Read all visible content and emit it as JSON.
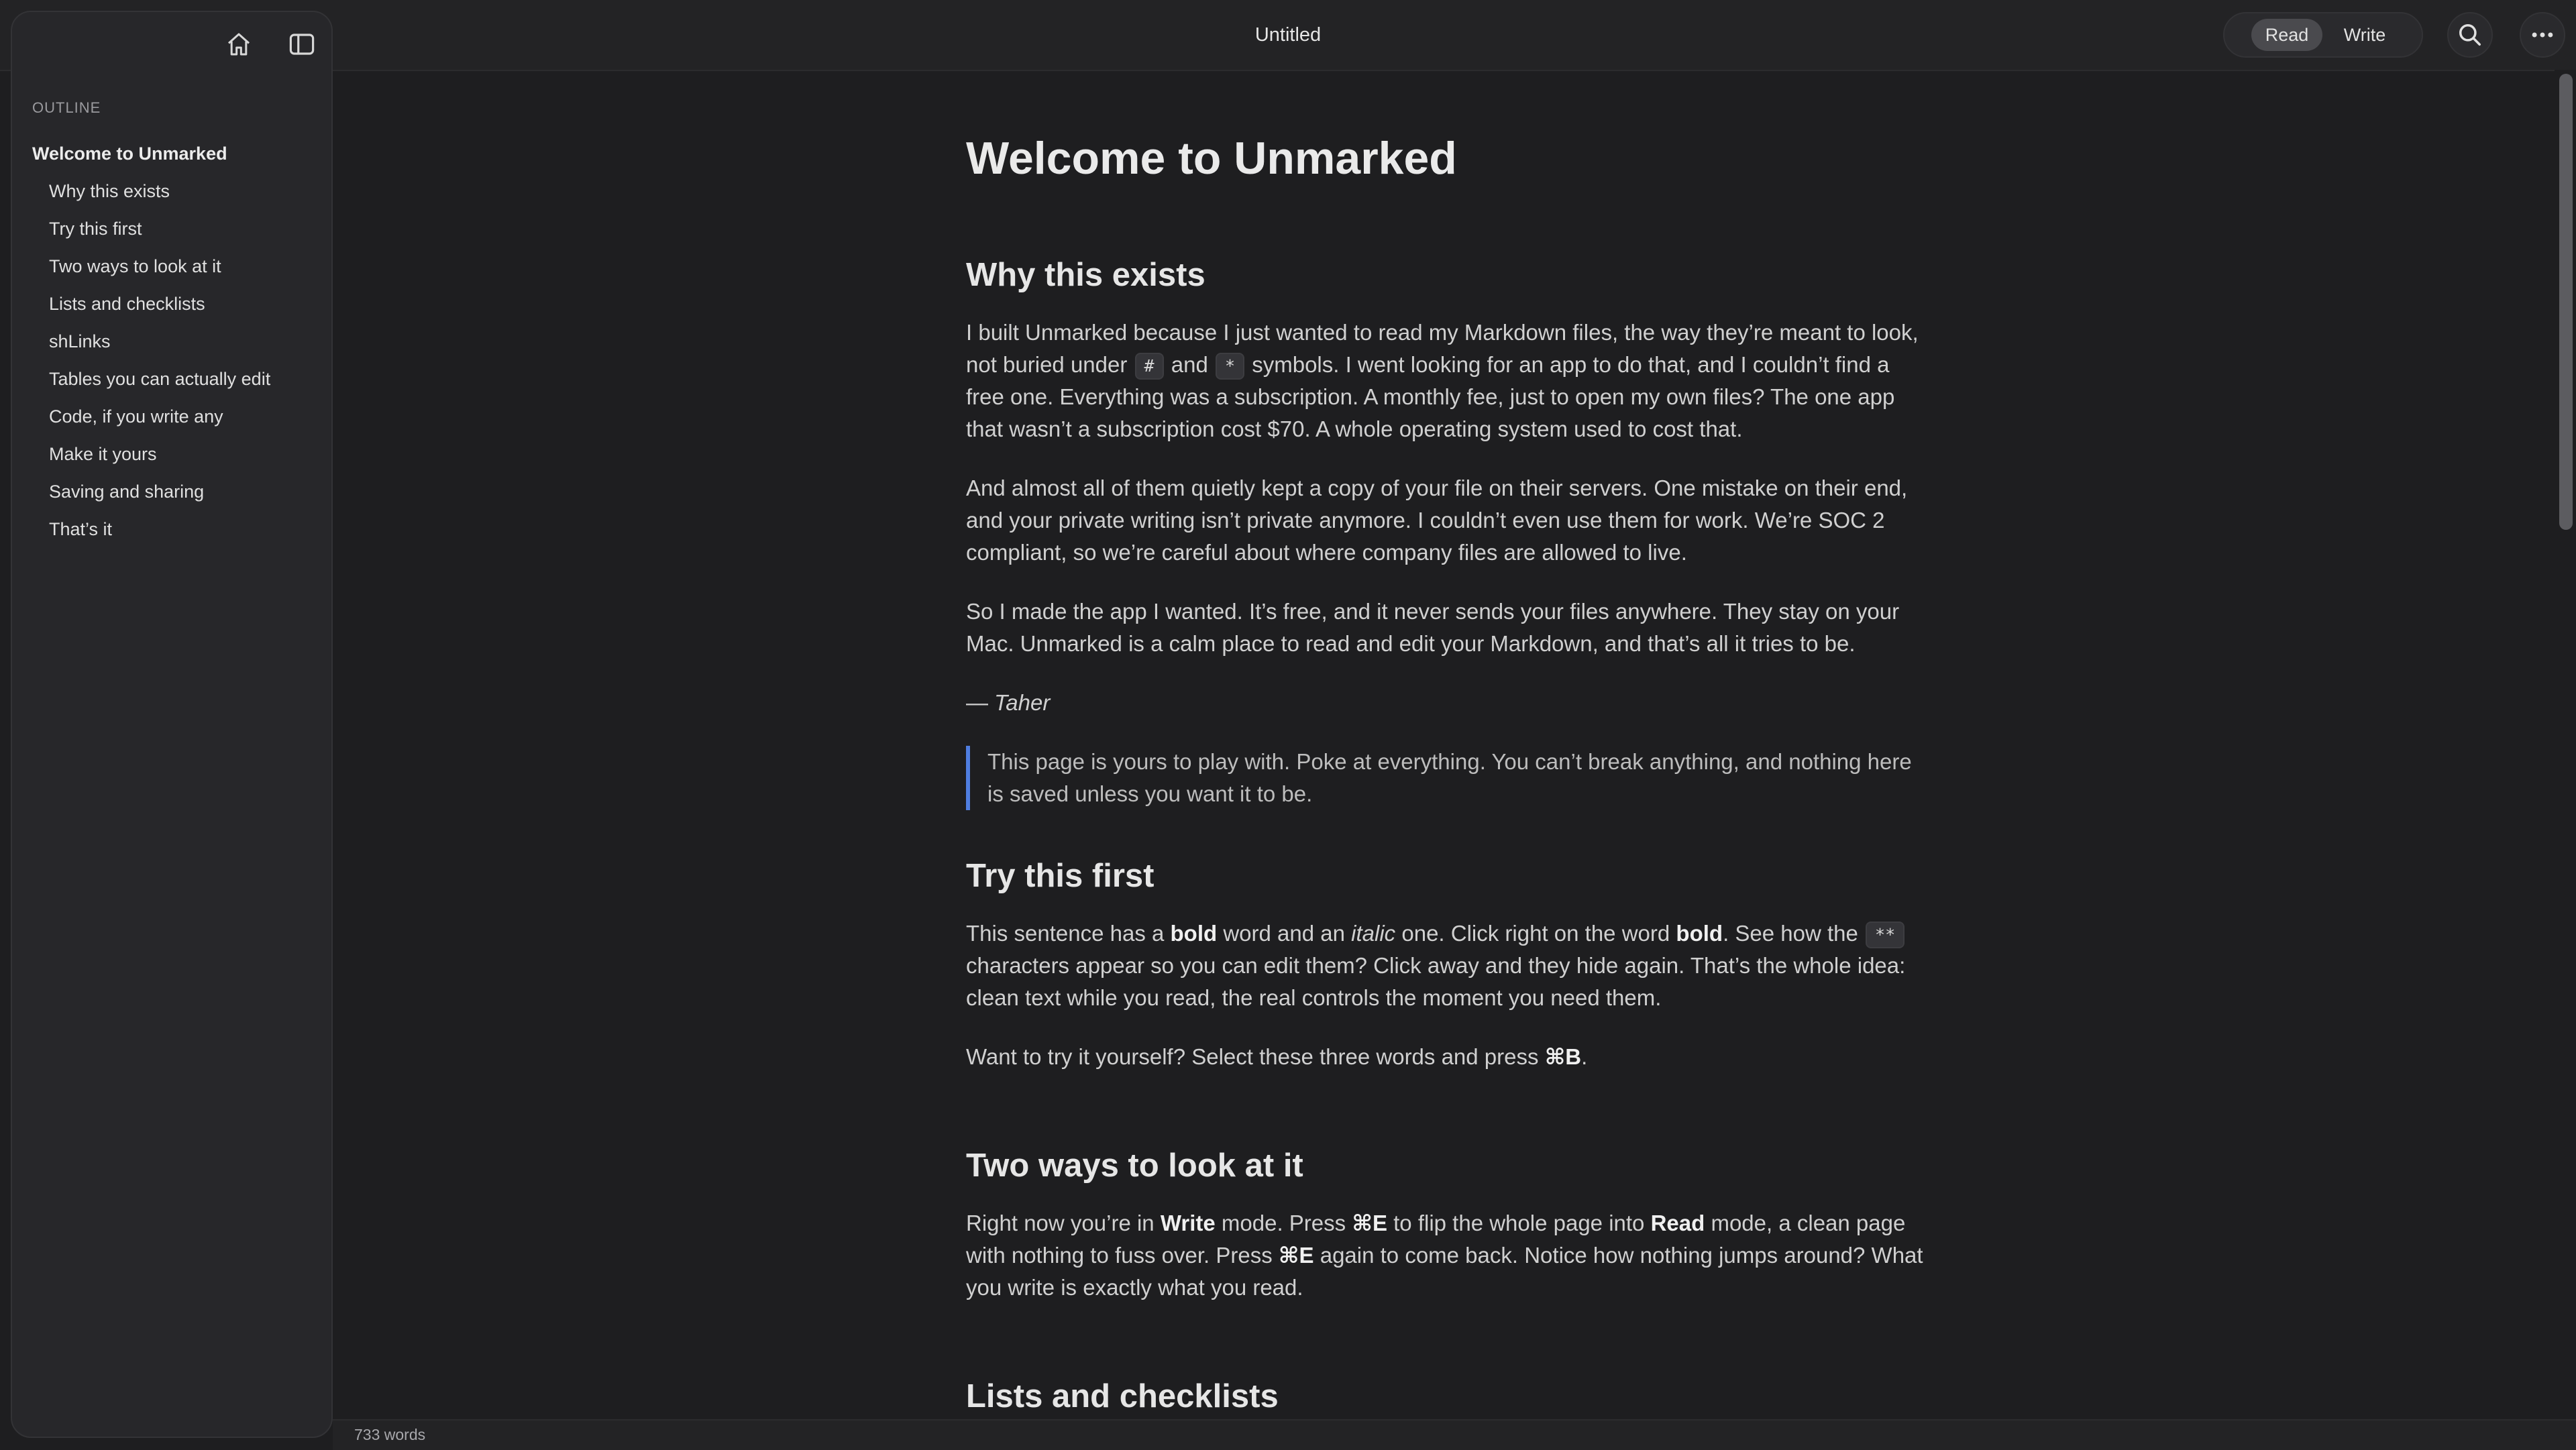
{
  "window": {
    "title": "Untitled"
  },
  "toolbar": {
    "modes": [
      "Read",
      "Write"
    ],
    "active_mode": "Read",
    "icons": [
      "home-icon",
      "sidebar-toggle-icon",
      "search-icon",
      "more-icon"
    ]
  },
  "sidebar": {
    "heading": "OUTLINE",
    "items": [
      {
        "label": "Welcome to Unmarked",
        "level": 1
      },
      {
        "label": "Why this exists",
        "level": 2
      },
      {
        "label": "Try this first",
        "level": 2
      },
      {
        "label": "Two ways to look at it",
        "level": 2
      },
      {
        "label": "Lists and checklists",
        "level": 2
      },
      {
        "label": "shLinks",
        "level": 2
      },
      {
        "label": "Tables you can actually edit",
        "level": 2
      },
      {
        "label": "Code, if you write any",
        "level": 2
      },
      {
        "label": "Make it yours",
        "level": 2
      },
      {
        "label": "Saving and sharing",
        "level": 2
      },
      {
        "label": "That’s it",
        "level": 2
      }
    ]
  },
  "doc": {
    "title": "Welcome to Unmarked",
    "why": {
      "heading": "Why this exists",
      "p1": {
        "a": "I built Unmarked because I just wanted to read my Markdown files, the way they’re meant to look, not buried under",
        "code1": "#",
        "b": "and",
        "code2": "*",
        "c": "symbols. I went looking for an app to do that, and I couldn’t find a free one. Everything was a subscription. A monthly fee, just to open my own files? The one app that wasn’t a subscription cost $70. A whole operating system used to cost that."
      },
      "p2": "And almost all of them quietly kept a copy of your file on their servers. One mistake on their end, and your private writing isn’t private anymore. I couldn’t even use them for work. We’re SOC 2 compliant, so we’re careful about where company files are allowed to live.",
      "p3": "So I made the app I wanted. It’s free, and it never sends your files anywhere. They stay on your Mac. Unmarked is a calm place to read and edit your Markdown, and that’s all it tries to be.",
      "sig_dash": "—",
      "sig_name": "Taher",
      "quote": "This page is yours to play with. Poke at everything. You can’t break anything, and nothing here is saved unless you want it to be."
    },
    "try": {
      "heading": "Try this first",
      "p1": {
        "a": "This sentence has a",
        "bold1": "bold",
        "b": "word and an",
        "italic": "italic",
        "c": "one. Click right on the word",
        "bold2": "bold",
        "d": ". See how the",
        "code": "**",
        "e": "characters appear so you can edit them? Click away and they hide again. That’s the whole idea: clean text while you read, the real controls the moment you need them."
      },
      "p2": {
        "a": "Want to try it yourself? Select these three words and press",
        "key": "⌘B",
        "b": "."
      }
    },
    "two": {
      "heading": "Two ways to look at it",
      "p1": {
        "a": "Right now you’re in",
        "write": "Write",
        "b": "mode. Press",
        "key1": "⌘E",
        "c": "to flip the whole page into",
        "read": "Read",
        "d": "mode, a clean page with nothing to fuss over. Press",
        "key2": "⌘E",
        "e": "again to come back. Notice how nothing jumps around? What you write is exactly what you read."
      }
    },
    "lists": {
      "heading": "Lists and checklists"
    }
  },
  "status": {
    "word_count": "733 words"
  }
}
